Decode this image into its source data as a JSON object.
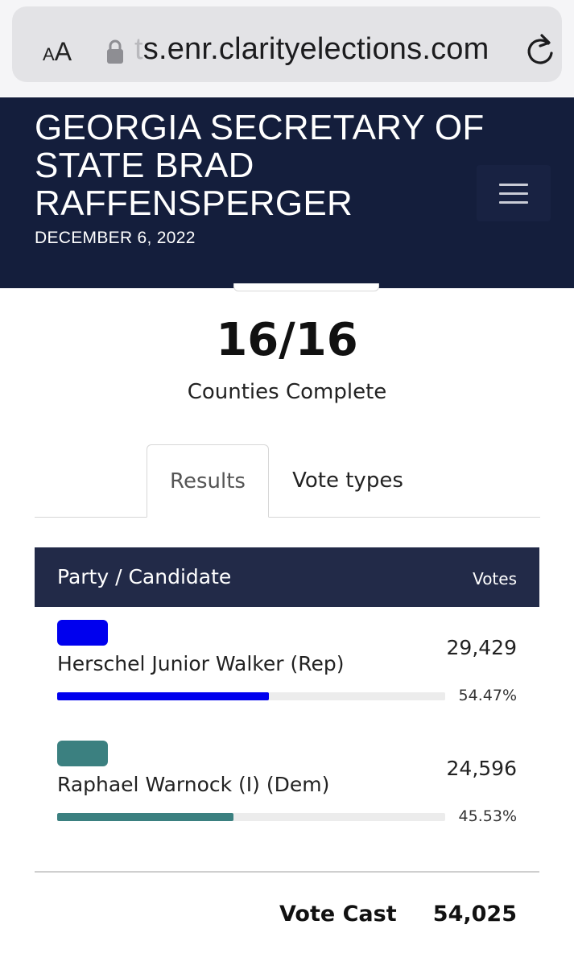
{
  "browser": {
    "aa_small": "A",
    "aa_big": "A",
    "url_faded": "t",
    "url_main": "s.enr.clarityelections.com",
    "icons": [
      "text-size-icon",
      "lock-icon",
      "reload-icon"
    ]
  },
  "header": {
    "title": "GEORGIA SECRETARY OF STATE BRAD RAFFENSPERGER",
    "date": "DECEMBER 6, 2022",
    "background": "#141e3c",
    "menu_icon": "hamburger-menu-icon"
  },
  "counties": {
    "count": "16/16",
    "label": "Counties Complete"
  },
  "tabs": [
    {
      "label": "Results",
      "active": true
    },
    {
      "label": "Vote types",
      "active": false
    }
  ],
  "table": {
    "header_candidate": "Party / Candidate",
    "header_votes": "Votes",
    "header_background": "#222a48",
    "candidates": [
      {
        "name": "Herschel Junior Walker (Rep)",
        "votes": "29,429",
        "percent": "54.47%",
        "share": 0.5447,
        "color": "#0000ee"
      },
      {
        "name": "Raphael Warnock (I) (Dem)",
        "votes": "24,596",
        "percent": "45.53%",
        "share": 0.4553,
        "color": "#3b8080"
      }
    ]
  },
  "totals": {
    "label": "Vote Cast",
    "value": "54,025"
  }
}
